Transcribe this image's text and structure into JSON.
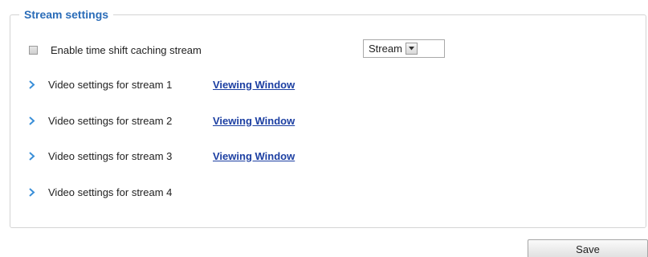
{
  "fieldset": {
    "legend": "Stream settings"
  },
  "time_shift": {
    "label": "Enable time shift caching stream",
    "checked": false,
    "select_value": "Stream"
  },
  "streams": [
    {
      "label": "Video settings for stream 1",
      "link": "Viewing Window"
    },
    {
      "label": "Video settings for stream 2",
      "link": "Viewing Window"
    },
    {
      "label": "Video settings for stream 3",
      "link": "Viewing Window"
    },
    {
      "label": "Video settings for stream 4",
      "link": ""
    }
  ],
  "buttons": {
    "save": "Save"
  },
  "colors": {
    "legend": "#2a6cb8",
    "link": "#1c3fa2",
    "chevron": "#3a8fd8"
  },
  "icons": {
    "expand": "chevron-right-icon",
    "dropdown": "triangle-down-icon"
  }
}
